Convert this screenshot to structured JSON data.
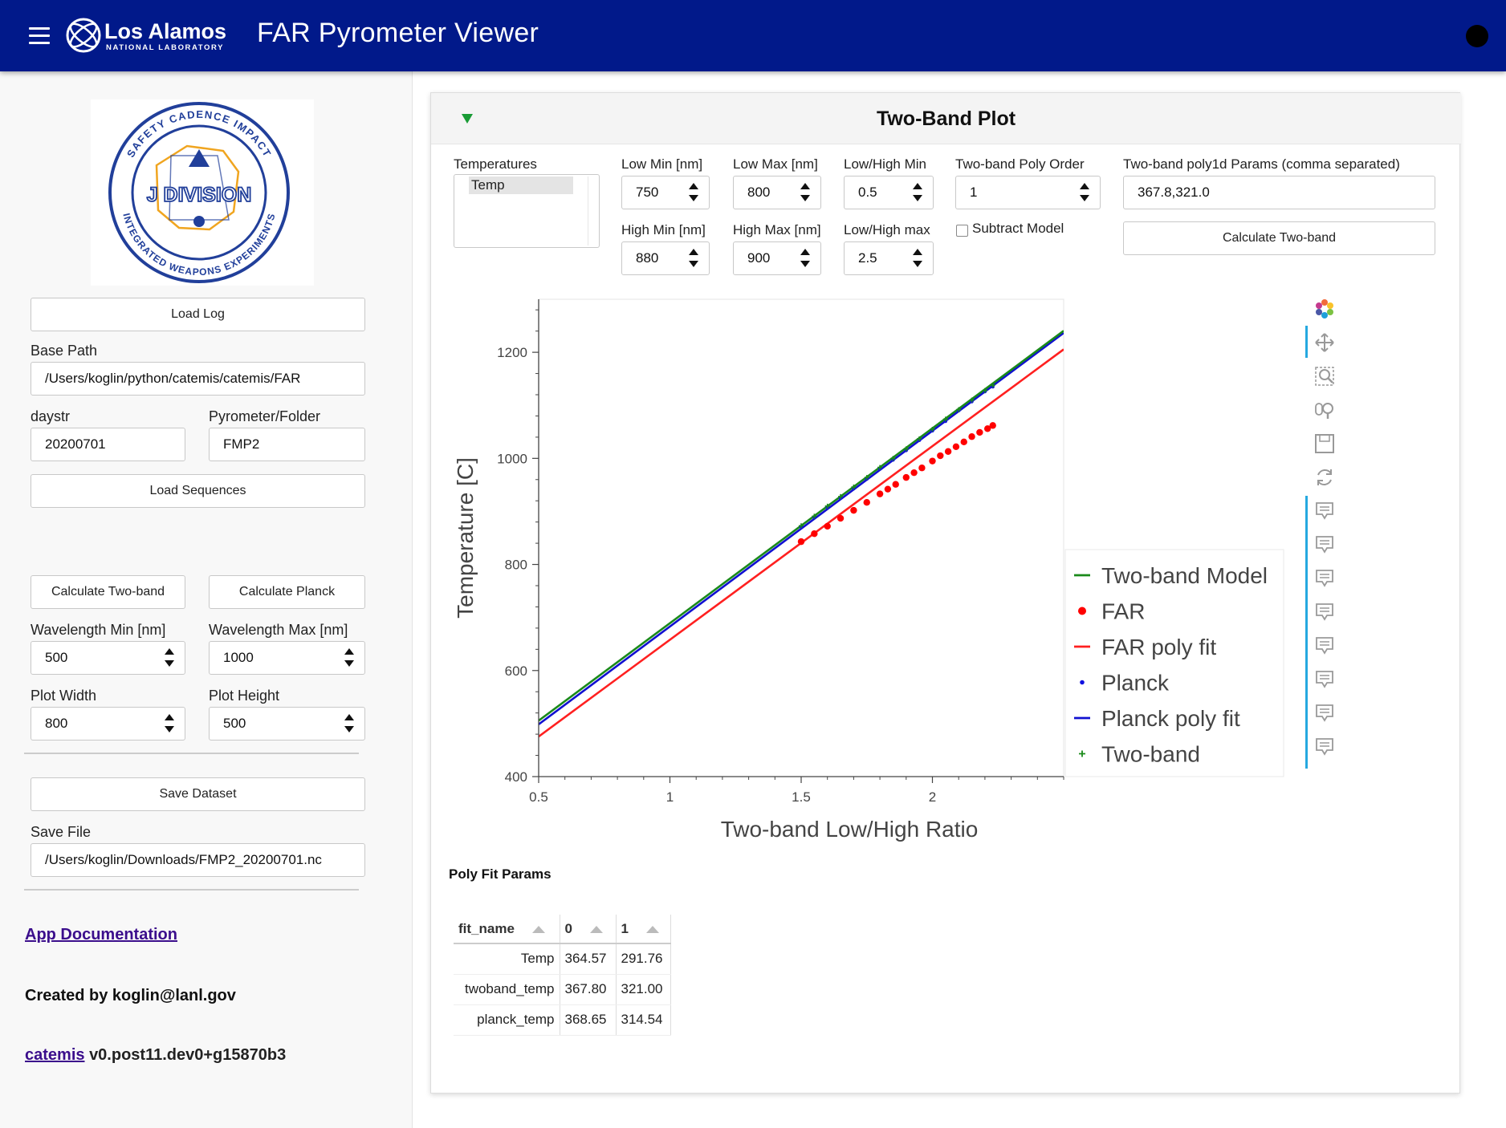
{
  "header": {
    "app_title": "FAR Pyrometer Viewer",
    "logo_text": "Los Alamos",
    "logo_subtext": "NATIONAL LABORATORY",
    "colors": {
      "header_bg": "#01198a"
    }
  },
  "sidebar": {
    "badge": {
      "top_arc": "SAFETY   CADENCE   IMPACT",
      "center": "J DIVISION",
      "bottom_arc": "INTEGRATED WEAPONS EXPERIMENTS"
    },
    "load_log_label": "Load Log",
    "base_path_label": "Base Path",
    "base_path_value": "/Users/koglin/python/catemis/catemis/FAR",
    "daystr_label": "daystr",
    "daystr_value": "20200701",
    "pyrometer_label": "Pyrometer/Folder",
    "pyrometer_value": "FMP2",
    "load_sequences_label": "Load Sequences",
    "calc_twoband_label": "Calculate Two-band",
    "calc_planck_label": "Calculate Planck",
    "wl_min_label": "Wavelength Min [nm]",
    "wl_min_value": "500",
    "wl_max_label": "Wavelength Max [nm]",
    "wl_max_value": "1000",
    "plot_width_label": "Plot Width",
    "plot_width_value": "800",
    "plot_height_label": "Plot Height",
    "plot_height_value": "500",
    "save_dataset_label": "Save Dataset",
    "save_file_label": "Save File",
    "save_file_value": "/Users/koglin/Downloads/FMP2_20200701.nc",
    "app_doc_link": "App Documentation",
    "created_by": "Created by koglin@lanl.gov",
    "catemis_link": "catemis",
    "version_text": "v0.post11.dev0+g15870b3"
  },
  "panel": {
    "title": "Two-Band Plot",
    "temperatures_label": "Temperatures",
    "temperatures_options": [
      "Temp"
    ],
    "low_min_label": "Low Min [nm]",
    "low_min_value": "750",
    "low_max_label": "Low Max [nm]",
    "low_max_value": "800",
    "low_high_min_label": "Low/High Min",
    "low_high_min_value": "0.5",
    "poly_order_label": "Two-band Poly Order",
    "poly_order_value": "1",
    "poly_params_label": "Two-band poly1d Params (comma separated)",
    "poly_params_value": "367.8,321.0",
    "high_min_label": "High Min [nm]",
    "high_min_value": "880",
    "high_max_label": "High Max [nm]",
    "high_max_value": "900",
    "low_high_max_label": "Low/High max",
    "low_high_max_value": "2.5",
    "subtract_model_label": "Subtract Model",
    "calc_twoband_label": "Calculate Two-band",
    "toggle_color": "#199b35"
  },
  "toolbar": {
    "icons": [
      "bokeh-logo-icon",
      "pan-icon",
      "box-zoom-icon",
      "wheel-zoom-icon",
      "save-icon",
      "reset-icon",
      "hover-icon",
      "hover-icon",
      "hover-icon",
      "hover-icon",
      "hover-icon",
      "hover-icon",
      "hover-icon",
      "hover-icon"
    ]
  },
  "chart_data": {
    "type": "line",
    "title": "",
    "xlabel": "Two-band Low/High Ratio",
    "ylabel": "Temperature [C]",
    "xlim": [
      0.5,
      2.5
    ],
    "ylim": [
      400,
      1300
    ],
    "xticks": [
      0.5,
      1,
      1.5,
      2
    ],
    "xtick_labels": [
      "0.5",
      "1",
      "1.5",
      "2"
    ],
    "yticks": [
      400,
      600,
      800,
      1000,
      1200
    ],
    "ytick_labels": [
      "400",
      "600",
      "800",
      "1000",
      "1200"
    ],
    "grid": false,
    "legend_position": "right",
    "series": [
      {
        "name": "Two-band Model",
        "kind": "line",
        "color": "#1a8a1a",
        "x": [
          0.5,
          2.5
        ],
        "y": [
          505.5,
          1240.5
        ]
      },
      {
        "name": "FAR",
        "kind": "points",
        "color": "#ff0000",
        "x": [
          1.5,
          1.55,
          1.6,
          1.65,
          1.7,
          1.75,
          1.8,
          1.83,
          1.86,
          1.9,
          1.93,
          1.96,
          2.0,
          2.03,
          2.06,
          2.09,
          2.12,
          2.15,
          2.18,
          2.21,
          2.23
        ],
        "y": [
          843,
          858,
          872,
          887,
          902,
          917,
          933,
          942,
          951,
          964,
          973,
          982,
          995,
          1005,
          1013,
          1022,
          1031,
          1041,
          1049,
          1056,
          1062
        ]
      },
      {
        "name": "FAR poly fit",
        "kind": "line",
        "color": "#ff2020",
        "x": [
          0.5,
          2.5
        ],
        "y": [
          475.5,
          1205.5
        ]
      },
      {
        "name": "Planck",
        "kind": "points",
        "color": "#1010e0",
        "x": [
          1.5,
          1.55,
          1.6,
          1.65,
          1.7,
          1.75,
          1.8,
          1.85,
          1.9,
          1.95,
          2.0,
          2.05,
          2.1,
          2.15,
          2.2,
          2.23
        ],
        "y": [
          871,
          889,
          908,
          925,
          943,
          961,
          980,
          997,
          1015,
          1034,
          1052,
          1070,
          1090,
          1107,
          1126,
          1135
        ]
      },
      {
        "name": "Planck poly fit",
        "kind": "line",
        "color": "#1010d0",
        "x": [
          0.5,
          2.5
        ],
        "y": [
          498.5,
          1236.5
        ]
      },
      {
        "name": "Two-band",
        "kind": "plus",
        "color": "#1a8a1a",
        "x": [
          1.5,
          1.55,
          1.6,
          1.65,
          1.7,
          1.75,
          1.8,
          1.85,
          1.9,
          1.95,
          2.0,
          2.05,
          2.1,
          2.15,
          2.2,
          2.23
        ],
        "y": [
          873,
          891,
          910,
          928,
          946,
          964,
          983,
          1000,
          1018,
          1037,
          1055,
          1074,
          1092,
          1110,
          1128,
          1138
        ]
      }
    ]
  },
  "poly_fit": {
    "title": "Poly Fit Params",
    "columns": [
      "fit_name",
      "0",
      "1"
    ],
    "rows": [
      [
        "Temp",
        "364.57",
        "291.76"
      ],
      [
        "twoband_temp",
        "367.80",
        "321.00"
      ],
      [
        "planck_temp",
        "368.65",
        "314.54"
      ]
    ]
  }
}
